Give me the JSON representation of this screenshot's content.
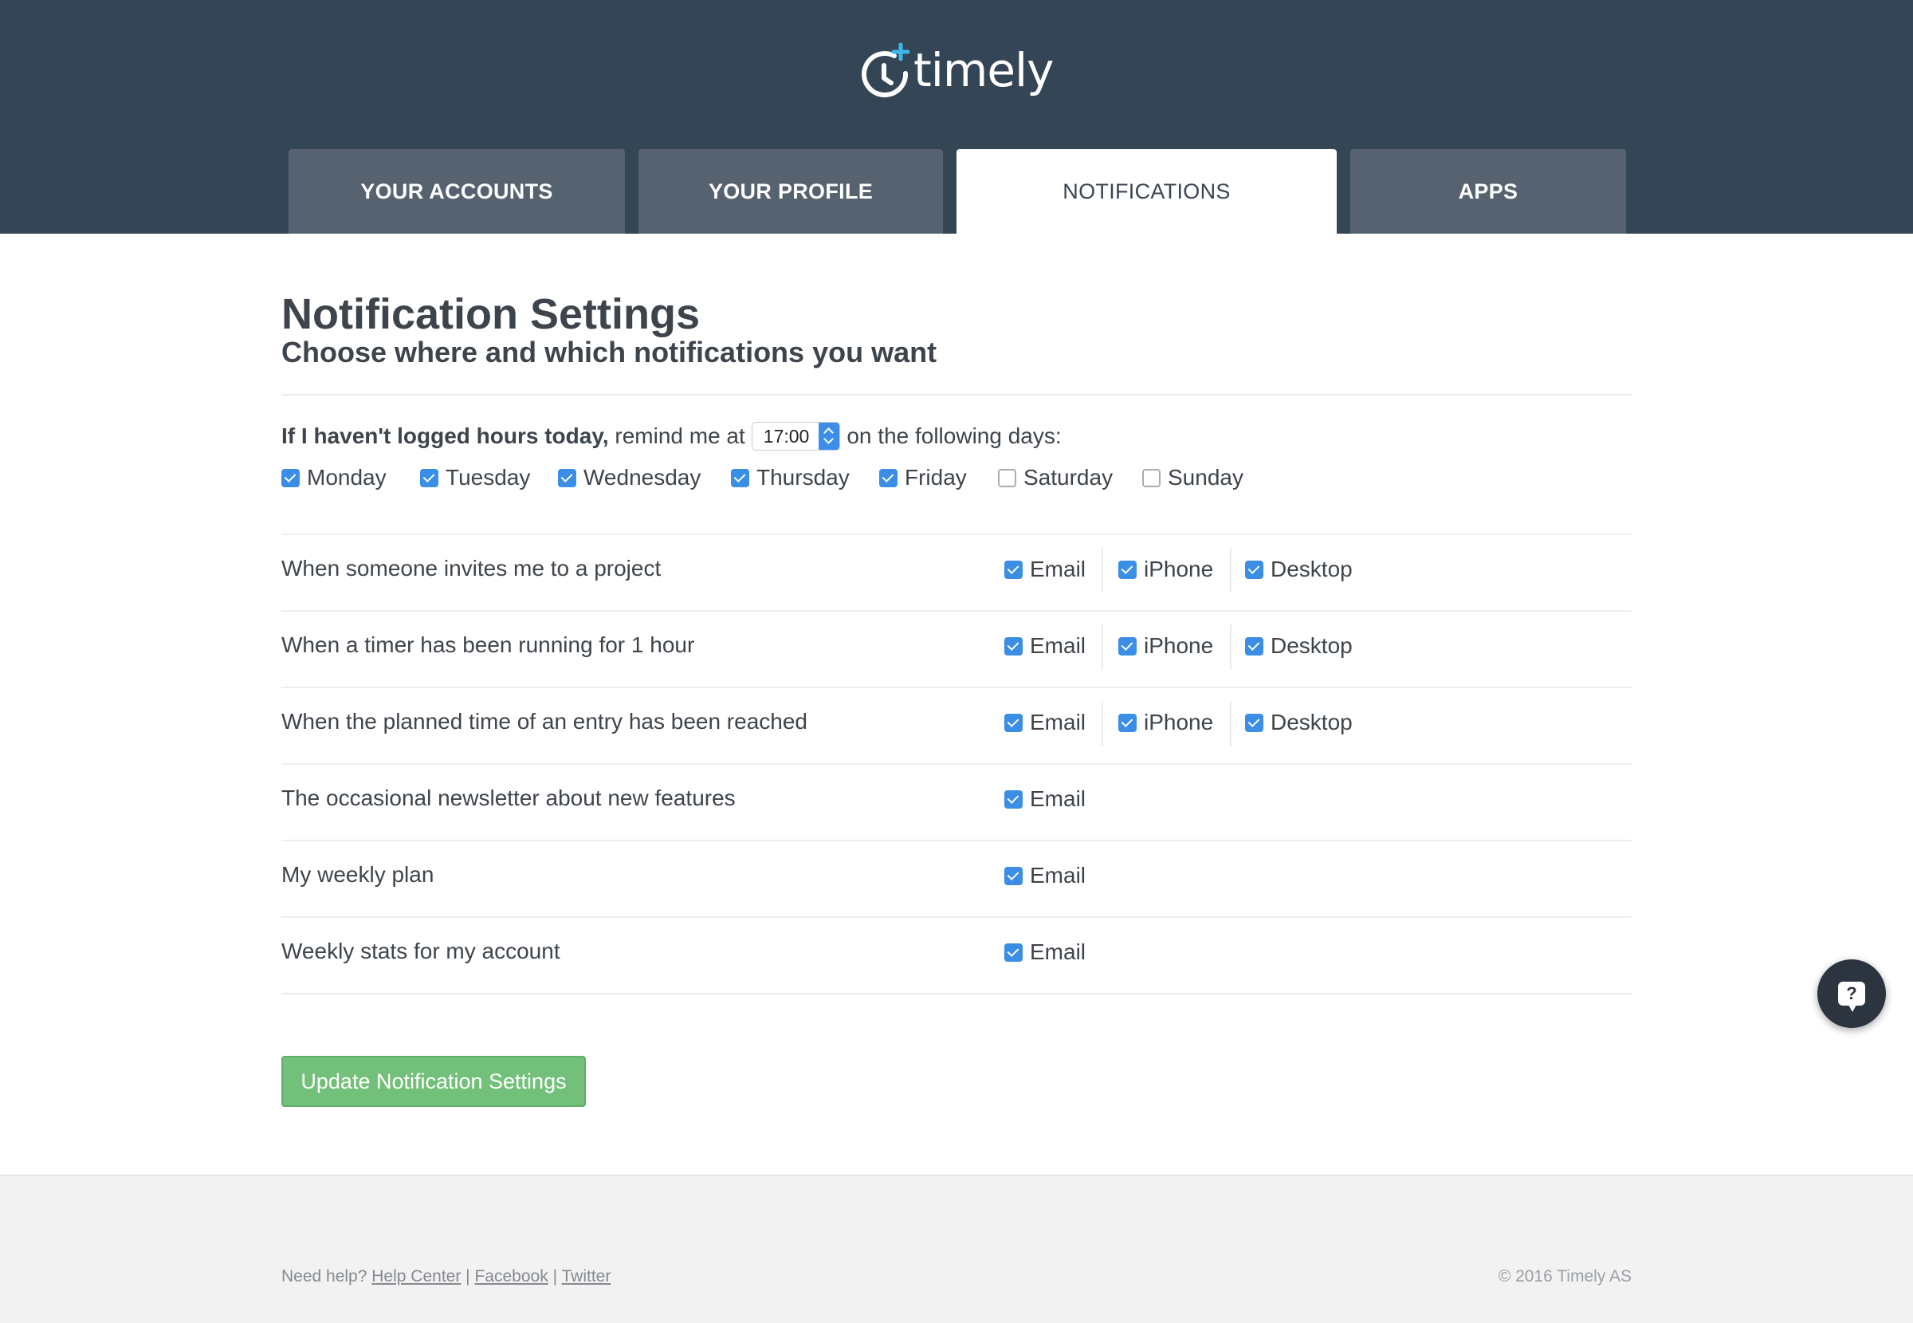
{
  "brand": {
    "name": "timely",
    "logo_icon": "clock-plus-icon"
  },
  "tabs": [
    {
      "label": "YOUR ACCOUNTS",
      "active": false
    },
    {
      "label": "YOUR PROFILE",
      "active": false
    },
    {
      "label": "NOTIFICATIONS",
      "active": true
    },
    {
      "label": "APPS",
      "active": false
    }
  ],
  "page": {
    "title": "Notification Settings",
    "subtitle": "Choose where and which notifications you want"
  },
  "reminder": {
    "bold_text": "If I haven't logged hours today,",
    "text_before": "remind me at",
    "time_value": "17:00",
    "text_after": "on the following days:"
  },
  "days": [
    {
      "label": "Monday",
      "checked": true
    },
    {
      "label": "Tuesday",
      "checked": true
    },
    {
      "label": "Wednesday",
      "checked": true
    },
    {
      "label": "Thursday",
      "checked": true
    },
    {
      "label": "Friday",
      "checked": true
    },
    {
      "label": "Saturday",
      "checked": false
    },
    {
      "label": "Sunday",
      "checked": false
    }
  ],
  "notifications": [
    {
      "label": "When someone invites me to a project",
      "email": "Email",
      "iphone": "iPhone",
      "desktop": "Desktop"
    },
    {
      "label": "When a timer has been running for 1 hour",
      "email": "Email",
      "iphone": "iPhone",
      "desktop": "Desktop"
    },
    {
      "label": "When the planned time of an entry has been reached",
      "email": "Email",
      "iphone": "iPhone",
      "desktop": "Desktop"
    },
    {
      "label": "The occasional newsletter about new features",
      "email": "Email"
    },
    {
      "label": "My weekly plan",
      "email": "Email"
    },
    {
      "label": "Weekly stats for my account",
      "email": "Email"
    }
  ],
  "submit_label": "Update Notification Settings",
  "footer": {
    "help_text": "Need help?",
    "links": [
      "Help Center",
      "Facebook",
      "Twitter"
    ],
    "separator": "|",
    "copyright": "© 2016 Timely AS"
  },
  "help_bubble": {
    "glyph": "?",
    "icon": "help-chat-icon"
  },
  "colors": {
    "header_bg": "#344555",
    "tab_bg": "#56626f",
    "checkbox_blue": "#3a8ee6",
    "button_green": "#72c07a",
    "logo_accent": "#3fb6e6"
  }
}
